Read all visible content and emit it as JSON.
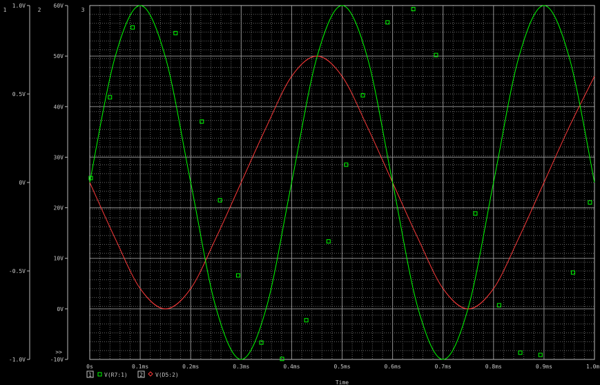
{
  "chart_data": {
    "type": "line",
    "title": "",
    "xlabel": "Time",
    "x_ticks": [
      "0s",
      "0.1ms",
      "0.2ms",
      "0.3ms",
      "0.4ms",
      "0.5ms",
      "0.6ms",
      "0.7ms",
      "0.8ms",
      "0.9ms",
      "1.0ms"
    ],
    "xlim": [
      0,
      1.0
    ],
    "x_unit": "ms",
    "grid": true,
    "axes": [
      {
        "id": "1",
        "ylim": [
          -1.0,
          1.0
        ],
        "ticks": [
          "1.0V",
          "0.5V",
          "0V",
          "-0.5V",
          "-1.0V"
        ]
      },
      {
        "id": "2",
        "ylim": [
          -10,
          60
        ],
        "ticks": [
          "60V",
          "50V",
          "40V",
          "30V",
          "20V",
          "10V",
          "0V",
          "-10V"
        ],
        "overflow_marker": ">>"
      },
      {
        "id": "3"
      }
    ],
    "legend_position": "bottom-left",
    "series": [
      {
        "name": "V(R7:1)",
        "axis": "1",
        "legend_key": "1",
        "color": "#00ff00",
        "marker": "square",
        "x": [
          0,
          0.05,
          0.1,
          0.15,
          0.2,
          0.25,
          0.3,
          0.35,
          0.4,
          0.45,
          0.5,
          0.55,
          0.6,
          0.65,
          0.7,
          0.75,
          0.8,
          0.85,
          0.9,
          0.95,
          1.0
        ],
        "y": [
          0,
          0.707,
          1.0,
          0.707,
          0,
          -0.707,
          -1.0,
          -0.707,
          0,
          0.707,
          1.0,
          0.707,
          0,
          -0.707,
          -1.0,
          -0.707,
          0,
          0.707,
          1.0,
          0.707,
          0
        ],
        "note_frequency_khz": 2.0
      },
      {
        "name": "V(D5:2)",
        "axis": "2",
        "legend_key": "2",
        "color": "#ff3b3b",
        "x": [
          0,
          0.05,
          0.1,
          0.15,
          0.2,
          0.25,
          0.3,
          0.35,
          0.4,
          0.45,
          0.5,
          0.55,
          0.6,
          0.65,
          0.7,
          0.75,
          0.8,
          0.85,
          0.9,
          0.95,
          1.0
        ],
        "y": [
          25,
          14,
          4,
          0,
          4,
          14,
          25,
          36,
          46,
          50,
          46,
          36,
          25,
          14,
          4,
          0,
          4,
          14,
          25,
          36,
          46
        ]
      }
    ]
  }
}
